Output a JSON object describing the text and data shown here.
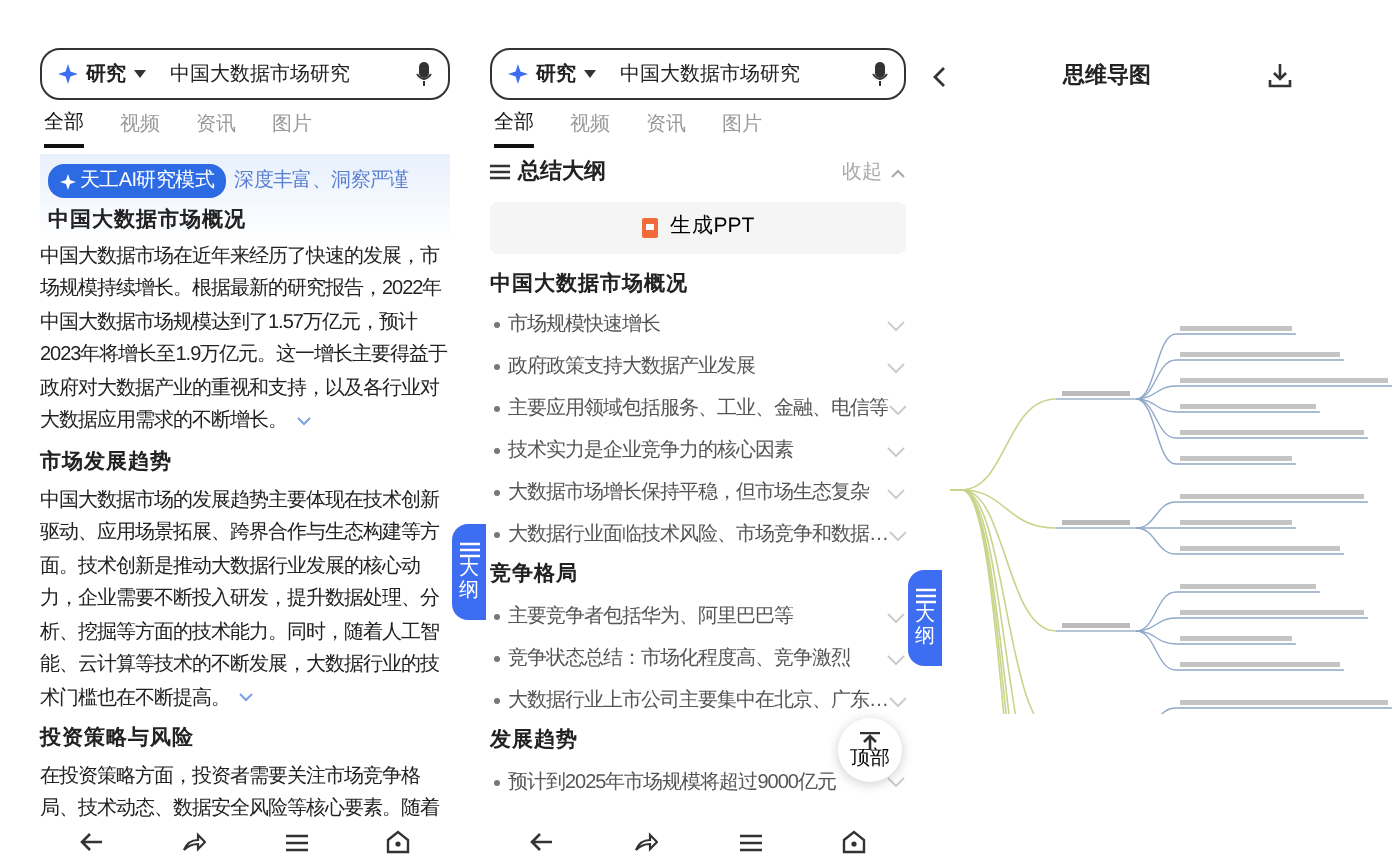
{
  "search_page": {
    "search": {
      "mode": "研究",
      "value": "中国大数据市场研究"
    },
    "tabs": [
      {
        "label": "全部",
        "selected": true
      },
      {
        "label": "视频",
        "selected": false
      },
      {
        "label": "资讯",
        "selected": false
      },
      {
        "label": "图片",
        "selected": false
      }
    ],
    "mode_badge": "天工AI研究模式",
    "mode_note": "深度丰富、洞察严谨",
    "sections": [
      {
        "heading": "中国大数据市场概况",
        "text": "中国大数据市场在近年来经历了快速的发展，市场规模持续增长。根据最新的研究报告，2022年中国大数据市场规模达到了1.57万亿元，预计2023年将增长至1.9万亿元。这一增长主要得益于政府对大数据产业的重视和支持，以及各行业对大数据应用需求的不断增长。"
      },
      {
        "heading": "市场发展趋势",
        "text": "中国大数据市场的发展趋势主要体现在技术创新驱动、应用场景拓展、跨界合作与生态构建等方面。技术创新是推动大数据行业发展的核心动力，企业需要不断投入研发，提升数据处理、分析、挖掘等方面的技术能力。同时，随着人工智能、云计算等技术的不断发展，大数据行业的技术门槛也在不断提高。"
      },
      {
        "heading": "投资策略与风险",
        "text": "在投资策略方面，投资者需要关注市场竞争格局、技术动态、数据安全风险等核心要素。随着"
      }
    ],
    "float_button": "大纲"
  },
  "outline_page": {
    "search": {
      "mode": "研究",
      "value": "中国大数据市场研究"
    },
    "tabs": [
      {
        "label": "全部",
        "selected": true
      },
      {
        "label": "视频",
        "selected": false
      },
      {
        "label": "资讯",
        "selected": false
      },
      {
        "label": "图片",
        "selected": false
      }
    ],
    "outline_title": "总结大纲",
    "collapse": "收起",
    "ppt_button": "生成PPT",
    "groups": [
      {
        "heading": "中国大数据市场概况",
        "items": [
          "市场规模快速增长",
          "政府政策支持大数据产业发展",
          "主要应用领域包括服务、工业、金融、电信等",
          "技术实力是企业竞争力的核心因素",
          "大数据市场增长保持平稳，但市场生态复杂",
          "大数据行业面临技术风险、市场竞争和数据…"
        ]
      },
      {
        "heading": "竞争格局",
        "items": [
          "主要竞争者包括华为、阿里巴巴等",
          "竞争状态总结：市场化程度高、竞争激烈",
          "大数据行业上市公司主要集中在北京、广东…"
        ]
      },
      {
        "heading": "发展趋势",
        "items": [
          "预计到2025年市场规模将超过9000亿元"
        ]
      }
    ],
    "float_button": "大纲",
    "top_button": "顶部"
  },
  "mindmap_page": {
    "title": "思维导图"
  }
}
